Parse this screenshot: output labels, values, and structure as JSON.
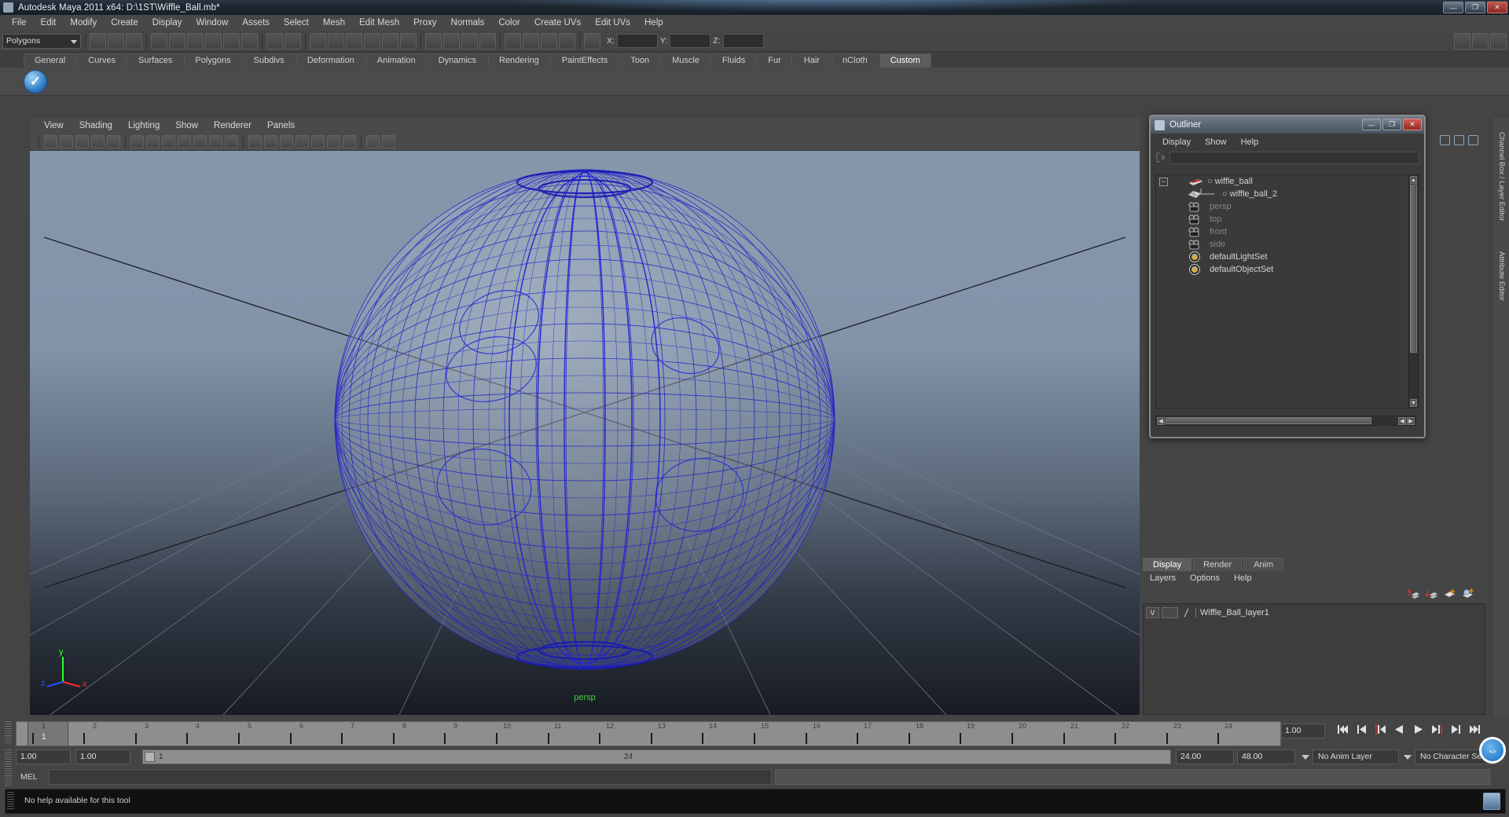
{
  "window": {
    "title": "Autodesk Maya 2011 x64: D:\\1ST\\Wiffle_Ball.mb*",
    "app_icon": "maya-icon",
    "minimize": "—",
    "maximize": "❐",
    "close": "✕"
  },
  "menubar": {
    "items": [
      "File",
      "Edit",
      "Modify",
      "Create",
      "Display",
      "Window",
      "Assets",
      "Select",
      "Mesh",
      "Edit Mesh",
      "Proxy",
      "Normals",
      "Color",
      "Create UVs",
      "Edit UVs",
      "Help"
    ]
  },
  "toolbar": {
    "mode_selector": "Polygons",
    "coord_labels": {
      "x": "X:",
      "y": "Y:",
      "z": "Z:"
    },
    "coord_values": {
      "x": "",
      "y": "",
      "z": ""
    }
  },
  "shelf": {
    "tabs": [
      "General",
      "Curves",
      "Surfaces",
      "Polygons",
      "Subdivs",
      "Deformation",
      "Animation",
      "Dynamics",
      "Rendering",
      "PaintEffects",
      "Toon",
      "Muscle",
      "Fluids",
      "Fur",
      "Hair",
      "nCloth",
      "Custom"
    ],
    "active_tab": "Custom",
    "active_icon": "checkmark-sphere-icon"
  },
  "viewport": {
    "menu": [
      "View",
      "Shading",
      "Lighting",
      "Show",
      "Renderer",
      "Panels"
    ],
    "camera_label": "persp",
    "axis": {
      "x": "x",
      "y": "y",
      "z": "z"
    },
    "colors": {
      "wireframe": "#2020c8",
      "sky": "#8596ab",
      "ground": "#171b22",
      "camera_label": "#3ad13a",
      "axis_x": "#ff2b2b",
      "axis_y": "#2bff2b",
      "axis_z": "#2b4bff"
    }
  },
  "outliner": {
    "title": "Outliner",
    "icon": "maya-icon",
    "minimize": "—",
    "maximize": "❐",
    "close": "✕",
    "menu": [
      "Display",
      "Show",
      "Help"
    ],
    "search_value": "",
    "tree": [
      {
        "label": "wiffle_ball",
        "icon": "transform-icon",
        "indent": 0,
        "dim": false,
        "expander": "−"
      },
      {
        "label": "wiffle_ball_2",
        "icon": "mesh-icon",
        "indent": 1,
        "dim": false,
        "expander": ""
      },
      {
        "label": "persp",
        "icon": "camera-icon",
        "indent": 1,
        "dim": true,
        "expander": ""
      },
      {
        "label": "top",
        "icon": "camera-icon",
        "indent": 1,
        "dim": true,
        "expander": ""
      },
      {
        "label": "front",
        "icon": "camera-icon",
        "indent": 1,
        "dim": true,
        "expander": ""
      },
      {
        "label": "side",
        "icon": "camera-icon",
        "indent": 1,
        "dim": true,
        "expander": ""
      },
      {
        "label": "defaultLightSet",
        "icon": "set-icon",
        "indent": 1,
        "dim": false,
        "expander": ""
      },
      {
        "label": "defaultObjectSet",
        "icon": "set-icon",
        "indent": 1,
        "dim": false,
        "expander": ""
      }
    ]
  },
  "layer_editor": {
    "tabs": [
      "Display",
      "Render",
      "Anim"
    ],
    "active_tab": "Display",
    "menu": [
      "Layers",
      "Options",
      "Help"
    ],
    "layers": [
      {
        "visibility": "V",
        "type": "",
        "name": "Wiffle_Ball_layer1"
      }
    ]
  },
  "timeline": {
    "ticks": [
      "1",
      "2",
      "3",
      "4",
      "5",
      "6",
      "7",
      "8",
      "9",
      "10",
      "11",
      "12",
      "13",
      "14",
      "15",
      "16",
      "17",
      "18",
      "19",
      "20",
      "21",
      "22",
      "23",
      "24"
    ],
    "current_frame": "1",
    "current_frame_field": "1.00",
    "range_start": "1.00",
    "range_end": "1.00",
    "playback_start": "24.00",
    "playback_end": "48.00",
    "range_slider_value": "1",
    "range_slider_end": "24",
    "anim_layer": "No Anim Layer",
    "character_set": "No Character Set",
    "playback_buttons": [
      "go-to-start-icon",
      "step-back-keyframe-icon",
      "step-back-frame-icon",
      "play-backwards-icon",
      "play-forwards-icon",
      "step-forward-frame-icon",
      "step-forward-keyframe-icon",
      "go-to-end-icon"
    ]
  },
  "command_line": {
    "language": "MEL",
    "command_value": "",
    "output_value": ""
  },
  "help_line": {
    "text": "No help available for this tool"
  },
  "right_rail": {
    "labels": [
      "Channel Box / Layer Editor",
      "Attribute Editor"
    ]
  }
}
